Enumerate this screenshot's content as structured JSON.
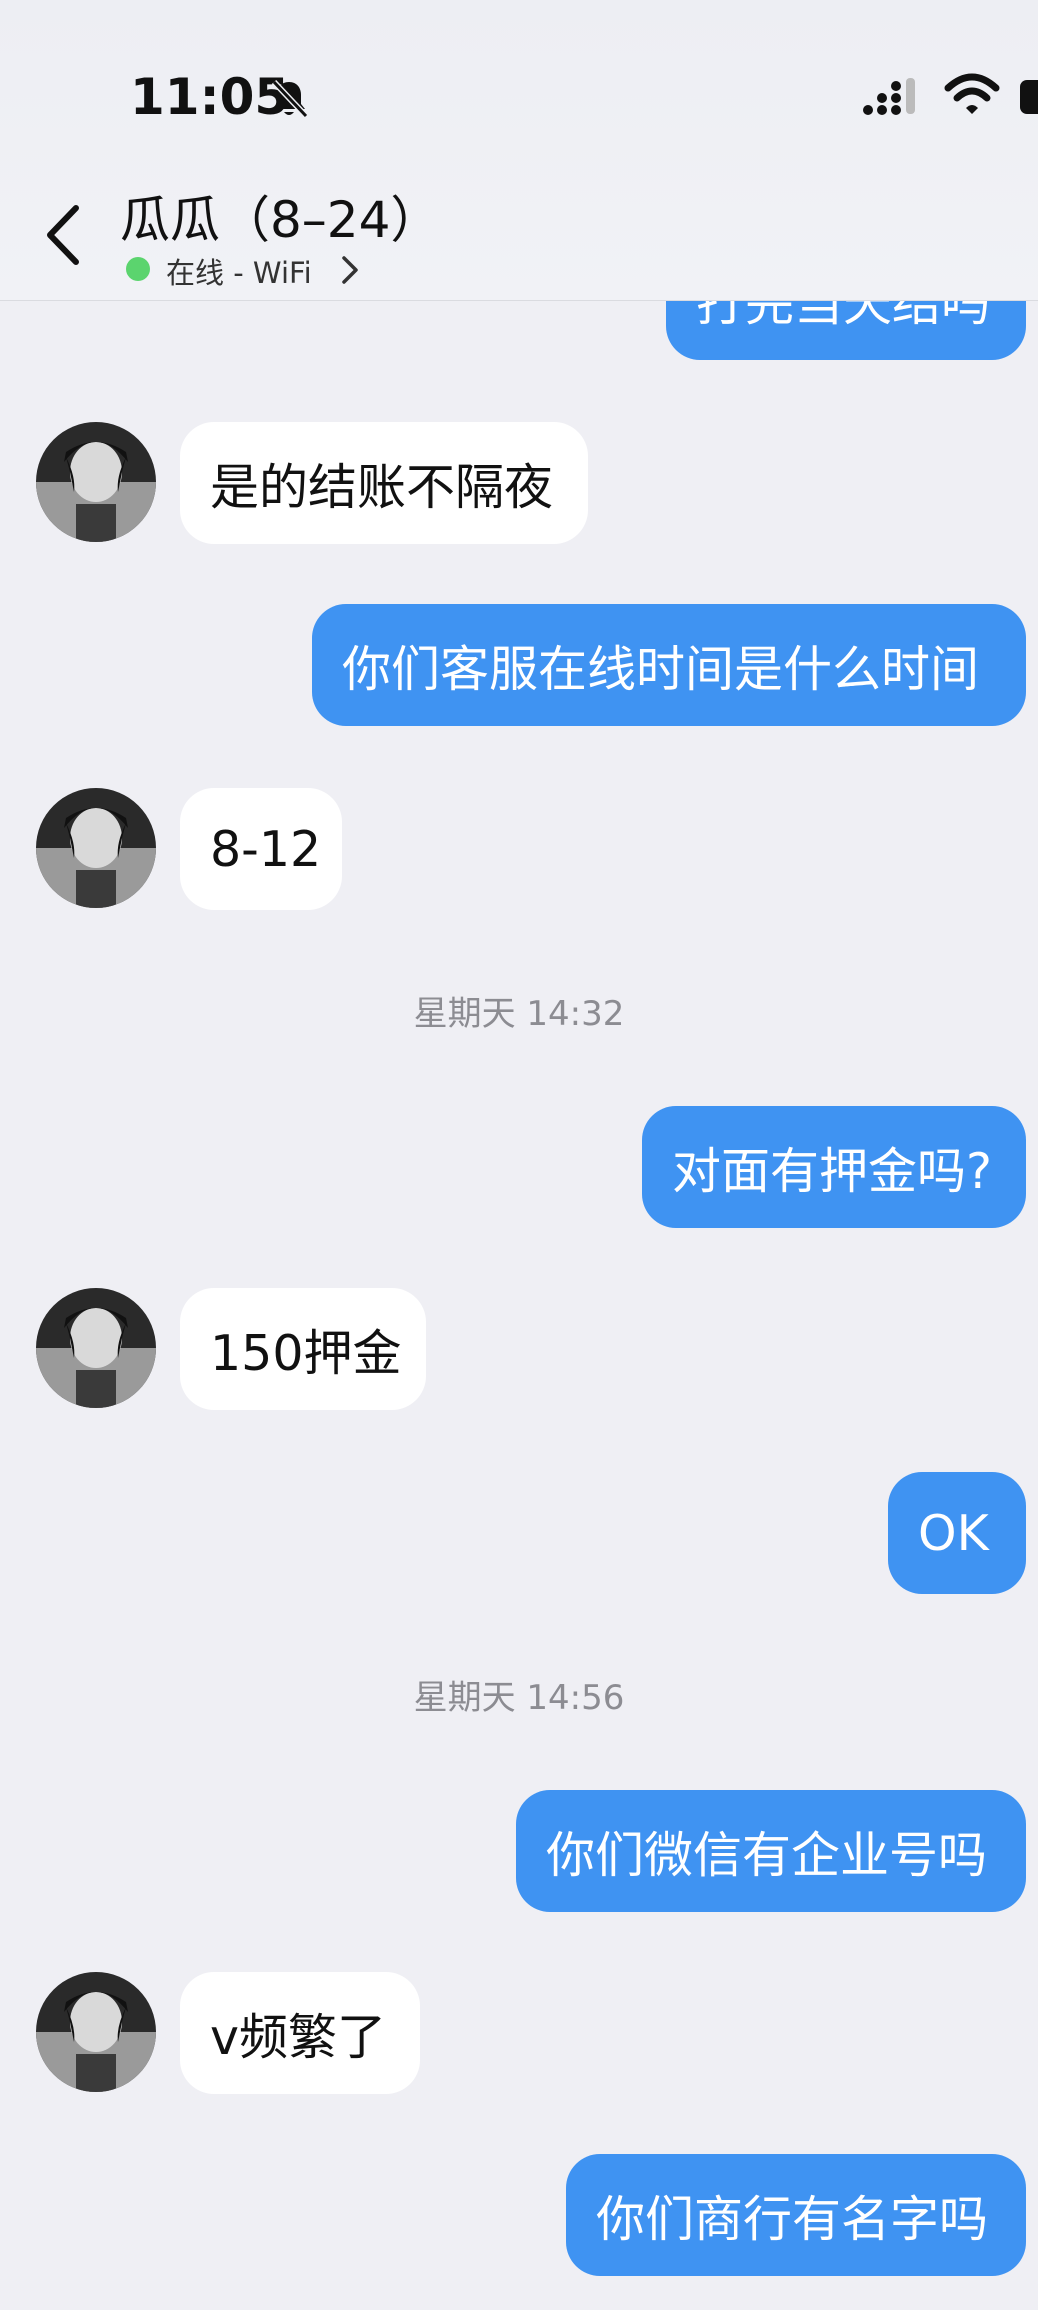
{
  "status_bar": {
    "time": "11:05"
  },
  "header": {
    "contact_name": "瓜瓜（8–24）",
    "online_status": "在线 - WiFi"
  },
  "messages": [
    {
      "direction": "out",
      "text": "打完当天结吗"
    },
    {
      "direction": "in",
      "text": "是的结账不隔夜"
    },
    {
      "direction": "out",
      "text": "你们客服在线时间是什么时间"
    },
    {
      "direction": "in",
      "text": "8-12"
    },
    {
      "direction": "timestamp",
      "text": "星期天 14:32"
    },
    {
      "direction": "out",
      "text": "对面有押金吗?"
    },
    {
      "direction": "in",
      "text": "150押金"
    },
    {
      "direction": "out",
      "text": "OK"
    },
    {
      "direction": "timestamp",
      "text": "星期天 14:56"
    },
    {
      "direction": "out",
      "text": "你们微信有企业号吗"
    },
    {
      "direction": "in",
      "text": "v频繁了"
    },
    {
      "direction": "out",
      "text": "你们商行有名字吗"
    }
  ],
  "colors": {
    "outgoing_bubble": "#3f93f2",
    "incoming_bubble": "#ffffff",
    "background": "#efeff4",
    "online_dot": "#5bd46e"
  },
  "icons": [
    "bell-slash-icon",
    "signal-icon",
    "wifi-icon",
    "battery-icon",
    "back-chevron-icon",
    "chevron-right-icon",
    "avatar-image"
  ]
}
